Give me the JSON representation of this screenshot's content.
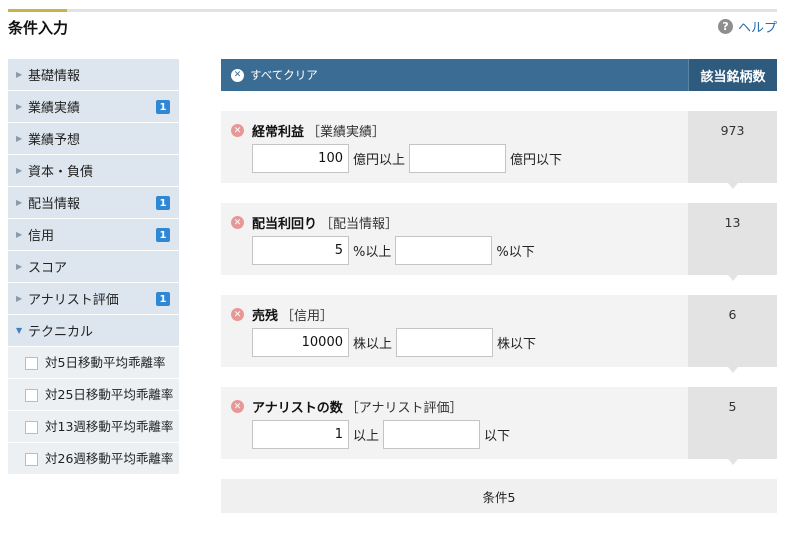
{
  "header": {
    "title": "条件入力",
    "help_label": "ヘルプ",
    "help_icon": "?"
  },
  "sidebar": {
    "items": [
      {
        "label": "基礎情報",
        "badge": ""
      },
      {
        "label": "業績実績",
        "badge": "1"
      },
      {
        "label": "業績予想",
        "badge": ""
      },
      {
        "label": "資本・負債",
        "badge": ""
      },
      {
        "label": "配当情報",
        "badge": "1"
      },
      {
        "label": "信用",
        "badge": "1"
      },
      {
        "label": "スコア",
        "badge": ""
      },
      {
        "label": "アナリスト評価",
        "badge": "1"
      }
    ],
    "open_section": "テクニカル",
    "sub_items": [
      "対5日移動平均乖離率",
      "対25日移動平均乖離率",
      "対13週移動平均乖離率",
      "対26週移動平均乖離率"
    ]
  },
  "main": {
    "clear_all": "すべてクリア",
    "count_header": "該当銘柄数",
    "conditions": [
      {
        "name": "経常利益",
        "category": "［業績実績］",
        "min": "100",
        "min_unit": "億円以上",
        "max": "",
        "max_unit": "億円以下",
        "count": "973"
      },
      {
        "name": "配当利回り",
        "category": "［配当情報］",
        "min": "5",
        "min_unit": "%以上",
        "max": "",
        "max_unit": "%以下",
        "count": "13"
      },
      {
        "name": "売残",
        "category": "［信用］",
        "min": "10000",
        "min_unit": "株以上",
        "max": "",
        "max_unit": "株以下",
        "count": "6"
      },
      {
        "name": "アナリストの数",
        "category": "［アナリスト評価］",
        "min": "1",
        "min_unit": "以上",
        "max": "",
        "max_unit": "以下",
        "count": "5"
      }
    ],
    "footer": "条件5"
  },
  "colors": {
    "header_bg": "#3b6d94",
    "badge": "#2f88d6",
    "remove_icon": "#e89797",
    "link": "#2a6db0"
  }
}
